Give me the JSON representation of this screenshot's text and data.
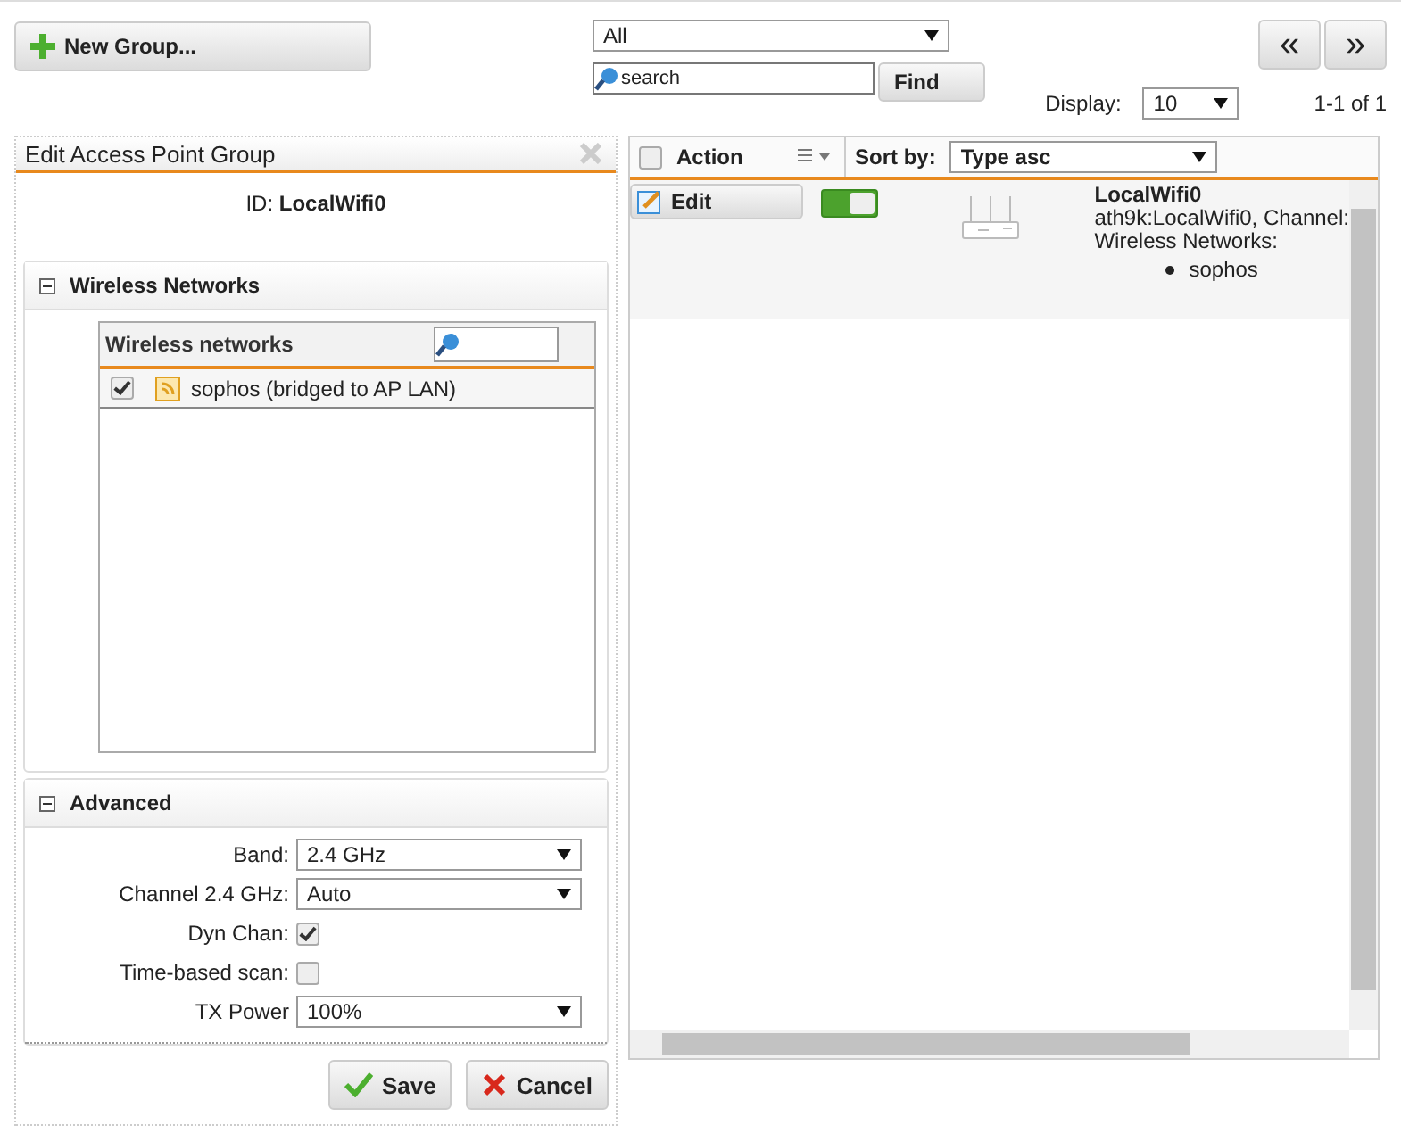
{
  "toolbar": {
    "new_button": "New Group...",
    "filter": "All",
    "search": {
      "placeholder": "search"
    },
    "find_button": "Find",
    "display_label": "Display:",
    "display_value": "10",
    "count": "1-1 of 1",
    "prev_button": "«",
    "next_button": "»"
  },
  "editor": {
    "title": "Edit Access Point Group",
    "id_label": "ID:",
    "id_value": "LocalWifi0",
    "wireless_section": {
      "title": "Wireless Networks",
      "expanded": true,
      "list_title": "Wireless networks",
      "items": [
        {
          "label": "sophos (bridged to AP LAN)",
          "checked": true
        }
      ]
    },
    "advanced_section": {
      "title": "Advanced",
      "expanded": true,
      "fields": [
        {
          "kind": "select",
          "label": "Band:",
          "value": "2.4 GHz"
        },
        {
          "kind": "select",
          "label": "Channel 2.4 GHz:",
          "value": "Auto"
        },
        {
          "kind": "checkbox",
          "label": "Dyn Chan:",
          "checked": true
        },
        {
          "kind": "checkbox",
          "label": "Time-based scan:",
          "checked": false
        },
        {
          "kind": "select",
          "label": "TX Power",
          "value": "100%"
        }
      ]
    },
    "save_button": "Save",
    "cancel_button": "Cancel"
  },
  "list": {
    "select_all": false,
    "action_label": "Action",
    "sort_label": "Sort by:",
    "sort_value": "Type asc",
    "rows": [
      {
        "edit_button": "Edit",
        "on": true,
        "name": "LocalWifi0",
        "detail": "ath9k:LocalWifi0, Channel:",
        "networks_label": "Wireless Networks:",
        "networks": [
          "sophos"
        ]
      }
    ]
  }
}
